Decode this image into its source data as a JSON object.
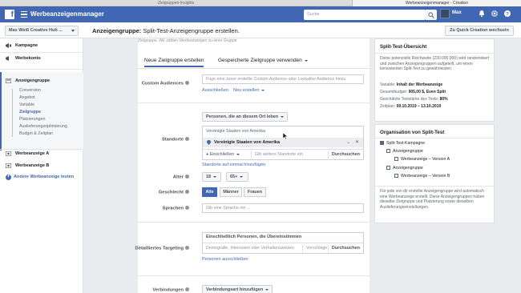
{
  "browser": {
    "tabs": [
      "Zielgruppen-Insights",
      "Werbeanzeigenmanager - Creation"
    ]
  },
  "topbar": {
    "app_title": "Werbeanzeigenmanager",
    "search_placeholder": "Suche",
    "username": "Max"
  },
  "header": {
    "account": "Max Weiß Creative Hub ...",
    "page_title_prefix": "Anzeigengruppe:",
    "page_title": "Split-Test-Anzeigengruppe erstellen.",
    "quick_creation": "Zu Quick Creation wechseln"
  },
  "sidebar": {
    "campaign": "Kampagne",
    "adaccount": "Werbekonto",
    "adgroup": "Anzeigengruppe",
    "subitems": [
      "Conversion",
      "Angebot",
      "Variable",
      "Zielgruppe",
      "Platzierungen",
      "Auslieferungsoptimierung",
      "Budget & Zeitplan"
    ],
    "active_subitem": "Zielgruppe",
    "ad_a": "Werbeanzeige A",
    "ad_b": "Werbeanzeige B",
    "add_test": "Andere Werbeanzeige testen"
  },
  "main": {
    "cut_text": "Zielgruppe. Wir zählen Werbeanzeigen zu einer Gruppe",
    "tabs": [
      "Neue Zielgruppe erstellen",
      "Gespeicherte Zielgruppe verwenden"
    ],
    "custom_audiences": {
      "label": "Custom Audiences",
      "placeholder": "Füge eine zuvor erstellte Custom Audience oder Lookalike Audience hinzu",
      "exclude": "Ausschließen",
      "new": "Neu erstellen"
    },
    "locations": {
      "label": "Standorte",
      "dropdown": "Personen, die an diesem Ort leben",
      "country": "Vereinigte Staaten von Amerika",
      "selected": "Vereinigte Staaten von Amerika",
      "mode": "Einschließen",
      "input_placeholder": "Gib weitere Standorte ein",
      "search": "Durchsuchen",
      "bulk_link": "Standorte auf einmal hinzufügen"
    },
    "age": {
      "label": "Alter",
      "min": "18",
      "max": "65+"
    },
    "gender": {
      "label": "Geschlecht",
      "options": [
        "Alle",
        "Männer",
        "Frauen"
      ],
      "selected": "Alle"
    },
    "languages": {
      "label": "Sprachen",
      "placeholder": "Gib eine Sprache ein ..."
    },
    "detailed": {
      "label": "Detailliertes Targeting",
      "header": "Einschließlich Personen, die Übereinstimmen",
      "placeholder": "Demografie, Interessen oder Verhaltensweisen",
      "suggestions": "Vorschläge",
      "search": "Durchsuchen",
      "exclude": "Personen ausschließen"
    },
    "connections": {
      "label": "Verbindungen",
      "button": "Verbindungsart hinzufügen"
    }
  },
  "overview": {
    "title": "Split-Test-Übersicht",
    "description": "Deine potenzielle Reichweite (230.000.000) wird randomisiert und zwischen Anzeigengruppen aufgeteilt, um einen konsistenten Split-Test zu gewährleisten.",
    "rows": [
      {
        "k": "Variable:",
        "v": "Inhalt der Werbeanzeige"
      },
      {
        "k": "Gesamtbudget:",
        "v": "905,00 $, Even Split"
      },
      {
        "k": "Geschätzte Teststärke des Tests:",
        "v": "80%"
      },
      {
        "k": "Zeitplan:",
        "v": "09.10.2019 – 13.10.2019"
      }
    ]
  },
  "organisation": {
    "title": "Organisation von Split-Test",
    "campaign": "Split-Test-Kampagne",
    "groups": [
      {
        "name": "Anzeigengruppe",
        "ad": "Werbeanzeige – Version A"
      },
      {
        "name": "Anzeigengruppe",
        "ad": "Werbeanzeige – Version B"
      }
    ],
    "note": "Für jede von dir erstellte Anzeigengruppe wird automatisch eine Werbeanzeige erstellt. Diese Anzeigengruppen haben dieselbe Zielgruppe und Platzierung sowie dieselben Auslieferungseinstellungen."
  },
  "colors": {
    "brand": "#4267b2",
    "link": "#4267b2",
    "page_bg": "#e9ebee"
  }
}
